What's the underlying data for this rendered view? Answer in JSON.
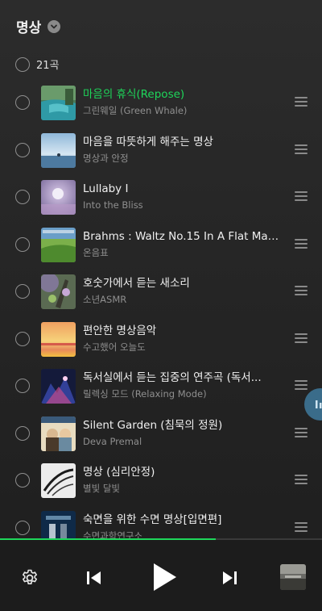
{
  "header": {
    "title": "명상",
    "dropdown_icon": "chevron-down-icon"
  },
  "select_all": {
    "count_label": "21곡"
  },
  "songs": [
    {
      "title": "마음의 휴식(Repose)",
      "artist": "그린웨일 (Green Whale)",
      "active": true
    },
    {
      "title": "마음을 따뜻하게 해주는 명상",
      "artist": "명상과 안정",
      "active": false
    },
    {
      "title": "Lullaby I",
      "artist": "Into the Bliss",
      "active": false
    },
    {
      "title": "Brahms : Waltz No.15 In A Flat Majo...",
      "artist": "온음표",
      "active": false
    },
    {
      "title": "호숫가에서 듣는 새소리",
      "artist": "소년ASMR",
      "active": false
    },
    {
      "title": "편안한 명상음악",
      "artist": "수고했어 오늘도",
      "active": false
    },
    {
      "title": "독서실에서 듣는 집중의 연주곡 (독서...",
      "artist": "릴렉싱 모드 (Relaxing Mode)",
      "active": false
    },
    {
      "title": "Silent Garden (침묵의 정원)",
      "artist": "Deva Premal",
      "active": false
    },
    {
      "title": "명상 (심리안정)",
      "artist": "별빛 달빛",
      "active": false
    },
    {
      "title": "숙면을 위한 수면 명상[입면편]",
      "artist": "수면과학연구소",
      "active": false
    }
  ],
  "player": {
    "progress": 0.67,
    "icons": [
      "gear-icon",
      "previous-icon",
      "play-icon",
      "next-icon"
    ]
  },
  "colors": {
    "accent": "#1ed65a",
    "background": "#262626",
    "player_bg": "#1c1c1c",
    "floating_button": "#3a6c8a"
  }
}
